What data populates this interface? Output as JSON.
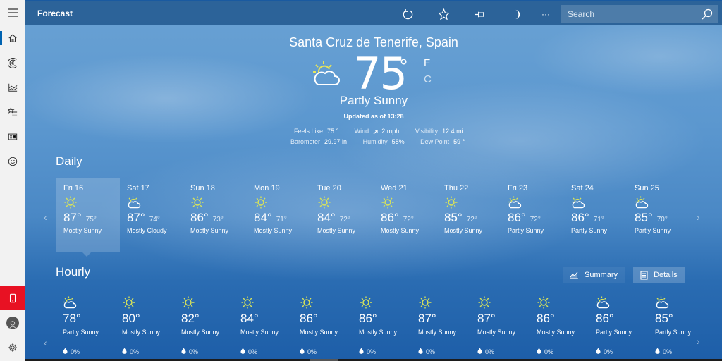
{
  "app": {
    "title": "Forecast",
    "search_placeholder": "Search"
  },
  "toolbar": {
    "icons": [
      "refresh-icon",
      "favorite-star-icon",
      "pin-icon",
      "dark-mode-moon-icon",
      "more-icon",
      "search-icon"
    ],
    "more_label": "···"
  },
  "sidebar": {
    "items": [
      {
        "name": "menu-hamburger-icon",
        "active": false
      },
      {
        "name": "home-icon",
        "active": true
      },
      {
        "name": "maps-radar-icon",
        "active": false
      },
      {
        "name": "historical-weather-icon",
        "active": false
      },
      {
        "name": "places-favorites-icon",
        "active": false
      },
      {
        "name": "news-icon",
        "active": false
      },
      {
        "name": "feedback-smiley-icon",
        "active": false
      }
    ],
    "bottom": [
      {
        "name": "phone-icon",
        "color": "#e81123"
      },
      {
        "name": "account-avatar-icon"
      },
      {
        "name": "settings-gear-icon"
      }
    ]
  },
  "current": {
    "location": "Santa Cruz de Tenerife, Spain",
    "temperature": "75",
    "degree_symbol": "°",
    "unit_f": "F",
    "unit_c": "C",
    "condition": "Partly Sunny",
    "updated": "Updated as of 13:28",
    "details": {
      "feels_like_label": "Feels Like",
      "feels_like_value": "75 °",
      "wind_label": "Wind",
      "wind_value": "2 mph",
      "visibility_label": "Visibility",
      "visibility_value": "12.4 mi",
      "barometer_label": "Barometer",
      "barometer_value": "29.97 in",
      "humidity_label": "Humidity",
      "humidity_value": "58%",
      "dew_point_label": "Dew Point",
      "dew_point_value": "59 °"
    }
  },
  "daily": {
    "title": "Daily",
    "selected_index": 0,
    "days": [
      {
        "day": "Fri 16",
        "icon": "sun",
        "hi": "87°",
        "lo": "75°",
        "condition": "Mostly Sunny"
      },
      {
        "day": "Sat 17",
        "icon": "partly",
        "hi": "87°",
        "lo": "74°",
        "condition": "Mostly Cloudy"
      },
      {
        "day": "Sun 18",
        "icon": "sun",
        "hi": "86°",
        "lo": "73°",
        "condition": "Mostly Sunny"
      },
      {
        "day": "Mon 19",
        "icon": "sun",
        "hi": "84°",
        "lo": "71°",
        "condition": "Mostly Sunny"
      },
      {
        "day": "Tue 20",
        "icon": "sun",
        "hi": "84°",
        "lo": "72°",
        "condition": "Mostly Sunny"
      },
      {
        "day": "Wed 21",
        "icon": "sun",
        "hi": "86°",
        "lo": "72°",
        "condition": "Mostly Sunny"
      },
      {
        "day": "Thu 22",
        "icon": "sun",
        "hi": "85°",
        "lo": "72°",
        "condition": "Mostly Sunny"
      },
      {
        "day": "Fri 23",
        "icon": "partly",
        "hi": "86°",
        "lo": "72°",
        "condition": "Partly Sunny"
      },
      {
        "day": "Sat 24",
        "icon": "partly",
        "hi": "86°",
        "lo": "71°",
        "condition": "Partly Sunny"
      },
      {
        "day": "Sun 25",
        "icon": "partly",
        "hi": "85°",
        "lo": "70°",
        "condition": "Partly Sunny"
      }
    ],
    "prev_arrow": "‹",
    "next_arrow": "›"
  },
  "hourly": {
    "title": "Hourly",
    "tabs": [
      {
        "label": "Summary",
        "selected": false
      },
      {
        "label": "Details",
        "selected": true
      }
    ],
    "hours": [
      {
        "icon": "partly",
        "temp": "78°",
        "condition": "Partly Sunny",
        "precip": "0%"
      },
      {
        "icon": "sun",
        "temp": "80°",
        "condition": "Mostly Sunny",
        "precip": "0%"
      },
      {
        "icon": "sun",
        "temp": "82°",
        "condition": "Mostly Sunny",
        "precip": "0%"
      },
      {
        "icon": "sun",
        "temp": "84°",
        "condition": "Mostly Sunny",
        "precip": "0%"
      },
      {
        "icon": "sun",
        "temp": "86°",
        "condition": "Mostly Sunny",
        "precip": "0%"
      },
      {
        "icon": "sun",
        "temp": "86°",
        "condition": "Mostly Sunny",
        "precip": "0%"
      },
      {
        "icon": "sun",
        "temp": "87°",
        "condition": "Mostly Sunny",
        "precip": "0%"
      },
      {
        "icon": "sun",
        "temp": "87°",
        "condition": "Mostly Sunny",
        "precip": "0%"
      },
      {
        "icon": "sun",
        "temp": "86°",
        "condition": "Mostly Sunny",
        "precip": "0%"
      },
      {
        "icon": "partly",
        "temp": "86°",
        "condition": "Partly Sunny",
        "precip": "0%"
      },
      {
        "icon": "partly",
        "temp": "85°",
        "condition": "Partly Sunny",
        "precip": "0%"
      }
    ],
    "prev_arrow": "‹",
    "next_arrow": "›"
  },
  "colors": {
    "accent": "#0063b1",
    "phone_red": "#e81123",
    "sun_yellow": "#d4e157"
  }
}
